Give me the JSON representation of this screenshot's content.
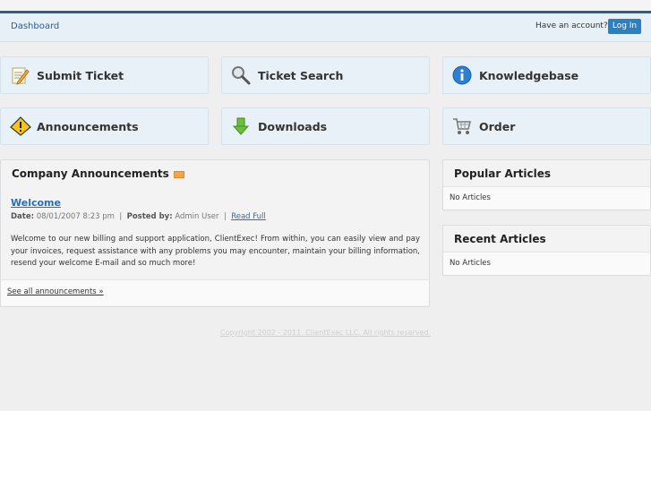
{
  "nav": {
    "dashboard": "Dashboard",
    "have_account": "Have an account?",
    "login": "Log In"
  },
  "tiles": [
    {
      "label": "Submit Ticket",
      "icon": "submit-ticket-icon"
    },
    {
      "label": "Ticket Search",
      "icon": "magnifier-icon"
    },
    {
      "label": "Knowledgebase",
      "icon": "info-icon"
    },
    {
      "label": "Announcements",
      "icon": "warning-icon"
    },
    {
      "label": "Downloads",
      "icon": "download-arrow-icon"
    },
    {
      "label": "Order",
      "icon": "shopping-cart-icon"
    }
  ],
  "announcements": {
    "title": "Company Announcements",
    "rss_icon": "rss-icon",
    "item": {
      "title": "Welcome",
      "date_label": "Date:",
      "date": "08/01/2007 8:23 pm",
      "sep": "|",
      "posted_label": "Posted by:",
      "posted_by": "Admin User",
      "read_full": "Read Full",
      "body": "Welcome to our new billing and support application, ClientExec! From within, you can easily view and pay your invoices, request assistance with any problems you may encounter, maintain your billing information, resend your welcome E-mail and so much more!"
    },
    "see_all": "See all announcements »"
  },
  "popular": {
    "title": "Popular Articles",
    "empty": "No Articles"
  },
  "recent": {
    "title": "Recent Articles",
    "empty": "No Articles"
  },
  "footer": {
    "copyright": "Copyright 2002 - 2011. ClientExec LLC. All rights reserved."
  },
  "colors": {
    "accent": "#2b7fc3",
    "tile_bg": "#e8f1f7",
    "link": "#2a6db2"
  }
}
